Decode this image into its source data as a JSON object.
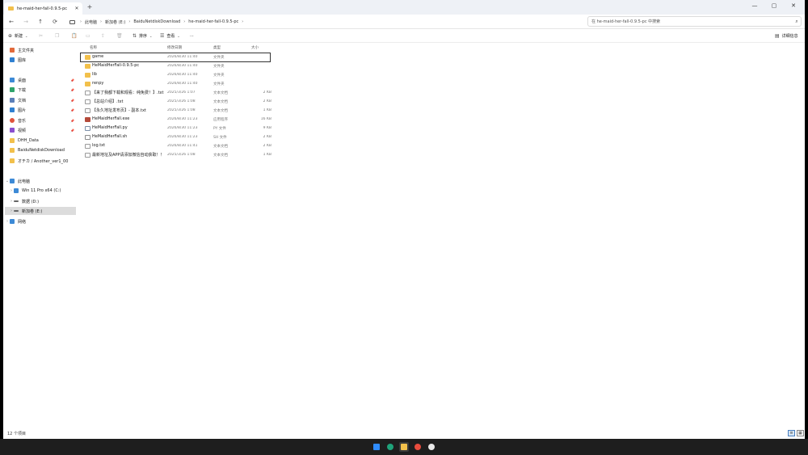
{
  "tab": {
    "title": "he-maid-her-fall-0.9.5-pc",
    "close": "✕",
    "new": "+"
  },
  "window_controls": {
    "minimize": "—",
    "maximize": "▢",
    "close": "✕"
  },
  "nav": {
    "back": "←",
    "forward": "→",
    "up": "↑",
    "refresh": "⟳"
  },
  "breadcrumb": [
    "此电脑",
    "新加卷 (E:)",
    "BaiduNetdiskDownload",
    "he-maid-her-fall-0.9.5-pc"
  ],
  "breadcrumb_separator": "›",
  "search": {
    "placeholder": "在 he-maid-her-fall-0.9.5-pc 中搜索",
    "icon": "search-icon"
  },
  "toolbar": {
    "new_label": "新建",
    "sort_label": "排序",
    "view_label": "查看",
    "more_label": "···",
    "details_label": "详细信息"
  },
  "sidebar": {
    "quick": [
      {
        "label": "主文件夹",
        "icon": "home-icon",
        "color": "#e26a3b"
      },
      {
        "label": "图库",
        "icon": "gallery-icon",
        "color": "#2f80d1"
      }
    ],
    "pinned": [
      {
        "label": "桌面",
        "icon": "desktop-icon",
        "color": "#3d8ad6"
      },
      {
        "label": "下载",
        "icon": "download-icon",
        "color": "#2fa36b"
      },
      {
        "label": "文档",
        "icon": "documents-icon",
        "color": "#5b7fb8"
      },
      {
        "label": "图片",
        "icon": "pictures-icon",
        "color": "#2f80d1"
      },
      {
        "label": "音乐",
        "icon": "music-icon",
        "color": "#e0533c"
      },
      {
        "label": "视频",
        "icon": "videos-icon",
        "color": "#8a4fcf"
      },
      {
        "label": "DHH_Data",
        "icon": "folder-icon",
        "color": "#f2c04b"
      },
      {
        "label": "BaiduNetdiskDownload",
        "icon": "folder-icon",
        "color": "#f2c04b"
      },
      {
        "label": "オチカ / Another_ver1_00",
        "icon": "folder-icon",
        "color": "#f2c04b"
      }
    ],
    "this_pc": {
      "label": "此电脑",
      "icon": "pc-icon",
      "color": "#3d8ad6"
    },
    "drives": [
      {
        "label": "Win 11 Pro x64 (C:)",
        "icon": "drive-icon",
        "color": "#3d8ad6"
      },
      {
        "label": "数据 (D:)",
        "icon": "drive-icon",
        "color": "#666666"
      },
      {
        "label": "新加卷 (E:)",
        "icon": "drive-icon",
        "color": "#666666"
      }
    ],
    "network": {
      "label": "网络",
      "icon": "network-icon",
      "color": "#3d8ad6"
    }
  },
  "columns": {
    "name": "名称",
    "date": "修改日期",
    "type": "类型",
    "size": "大小"
  },
  "files": [
    {
      "name": "game",
      "date": "2026/8/30 11:40",
      "type": "文件夹",
      "size": "",
      "kind": "folder"
    },
    {
      "name": "HeMaidHerFall-0.9.5-pc",
      "date": "2026/8/30 11:40",
      "type": "文件夹",
      "size": "",
      "kind": "folder"
    },
    {
      "name": "lib",
      "date": "2026/8/30 11:40",
      "type": "文件夹",
      "size": "",
      "kind": "folder"
    },
    {
      "name": "renpy",
      "date": "2026/8/30 11:40",
      "type": "文件夹",
      "size": "",
      "kind": "folder"
    },
    {
      "name": "【来了我都下载和观看：纯免费！】.txt",
      "date": "2025/3/26 1:07",
      "type": "文本文档",
      "size": "2 KB",
      "kind": "txt"
    },
    {
      "name": "【总站介绍】.txt",
      "date": "2025/3/26 1:08",
      "type": "文本文档",
      "size": "2 KB",
      "kind": "txt"
    },
    {
      "name": "【永久地址发布页】- 副本.txt",
      "date": "2025/3/26 1:08",
      "type": "文本文档",
      "size": "1 KB",
      "kind": "txt"
    },
    {
      "name": "HeMaidHerFall.exe",
      "date": "2026/8/30 11:23",
      "type": "应用程序",
      "size": "16 KB",
      "kind": "exe"
    },
    {
      "name": "HeMaidHerFall.py",
      "date": "2026/8/30 11:23",
      "type": "PY 文件",
      "size": "9 KB",
      "kind": "py"
    },
    {
      "name": "HeMaidHerFall.sh",
      "date": "2026/8/30 11:23",
      "type": "SH 文件",
      "size": "2 KB",
      "kind": "sh"
    },
    {
      "name": "log.txt",
      "date": "2026/8/30 11:41",
      "type": "文本文档",
      "size": "2 KB",
      "kind": "txt"
    },
    {
      "name": "最新地址及APP请添加微信自动获取！！.txt",
      "date": "2025/3/26 1:08",
      "type": "文本文档",
      "size": "1 KB",
      "kind": "txt"
    }
  ],
  "status": {
    "count": "12 个项目"
  },
  "taskbar": [
    {
      "icon": "start-icon",
      "color": "#2f8cff"
    },
    {
      "icon": "edge-icon",
      "color": "#1fa37a"
    },
    {
      "icon": "file-explorer-icon",
      "color": "#f2c04b"
    },
    {
      "icon": "chrome-icon",
      "color": "#e84c3d"
    },
    {
      "icon": "app-icon",
      "color": "#e8e8e8"
    }
  ]
}
